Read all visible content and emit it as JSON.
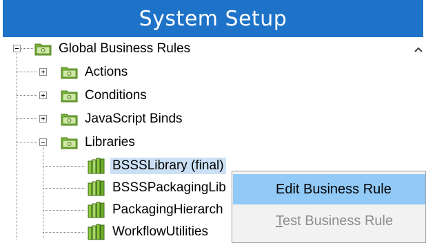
{
  "header": {
    "title": "System Setup"
  },
  "tree": {
    "root": {
      "label": "Global Business Rules",
      "expanded": true
    },
    "children": [
      {
        "label": "Actions",
        "expanded": false
      },
      {
        "label": "Conditions",
        "expanded": false
      },
      {
        "label": "JavaScript Binds",
        "expanded": false
      },
      {
        "label": "Libraries",
        "expanded": true
      }
    ],
    "libraries": [
      {
        "label": "BSSSLibrary (final)",
        "selected": true
      },
      {
        "label": "BSSSPackagingLib"
      },
      {
        "label": "PackagingHierarch"
      },
      {
        "label": "WorkflowUtilities"
      }
    ]
  },
  "context_menu": {
    "items": [
      {
        "label": "Edit Business Rule",
        "highlighted": true,
        "enabled": true
      },
      {
        "label_first": "T",
        "label_rest": "est Business Rule",
        "enabled": false
      }
    ]
  },
  "colors": {
    "header_bg": "#1e73c8",
    "selection_bg": "#cce0f5",
    "menu_highlight": "#91c9f7",
    "folder_green": "#7ab33a"
  },
  "icons": {
    "folder": "folder-icon",
    "library": "library-icon",
    "scroll": "chevron-up-icon"
  }
}
